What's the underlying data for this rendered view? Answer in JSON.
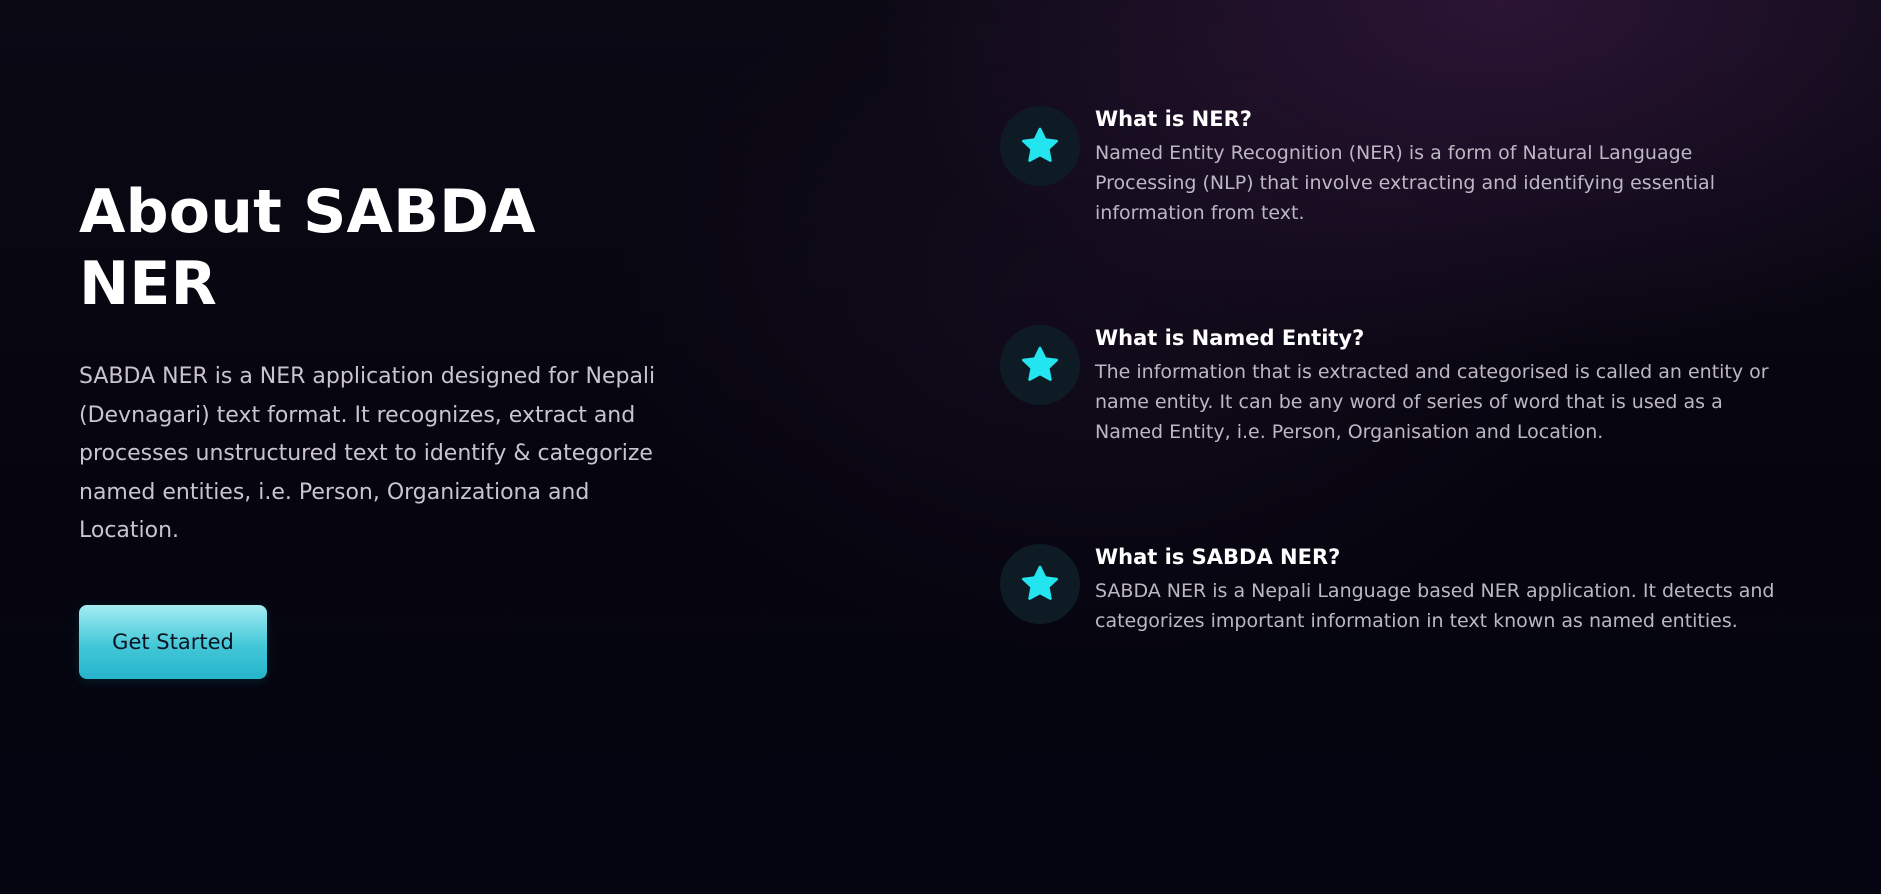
{
  "about": {
    "title": "About SABDA NER",
    "description": "SABDA NER is a NER application designed for Nepali (Devnagari) text format. It recognizes, extract and processes unstructured text to identify & categorize named entities, i.e. Person, Organizationa and Location.",
    "cta_label": "Get Started"
  },
  "features": [
    {
      "icon": "star-icon",
      "title": "What is NER?",
      "text": "Named Entity Recognition (NER) is a form of Natural Language Processing (NLP) that involve extracting and identifying essential information from text."
    },
    {
      "icon": "star-icon",
      "title": "What is Named Entity?",
      "text": "The information that is extracted and categorised is called an entity or name entity. It can be any word of series of word that is used as a Named Entity, i.e. Person, Organisation and Location."
    },
    {
      "icon": "star-icon",
      "title": "What is SABDA NER?",
      "text": "SABDA NER is a Nepali Language based NER application. It detects and categorizes important information in text known as named entities."
    }
  ],
  "colors": {
    "accent": "#22e5f0",
    "background": "#06050f",
    "button_gradient_top": "#a4ecf1",
    "button_gradient_bottom": "#25b4cb",
    "icon_circle": "#0f1b24"
  }
}
